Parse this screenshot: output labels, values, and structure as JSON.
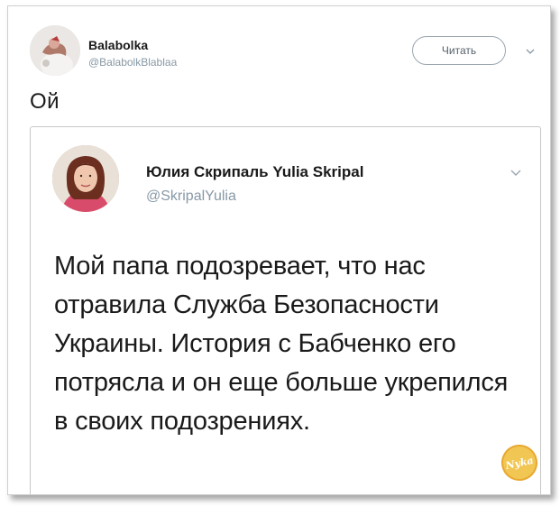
{
  "tweet": {
    "author_name": "Balabolka",
    "author_handle": "@BalabolkBlablaa",
    "follow_label": "Читать",
    "text": "Ой"
  },
  "quoted_tweet": {
    "author_name": "Юлия Скрипаль Yulia Skripal",
    "author_handle": "@SkripalYulia",
    "text": "Мой папа подозревает, что нас отравила Служба Безопасности Украины. История с Бабченко его потрясла и он еще больше укрепился в своих подозрениях."
  },
  "watermark": {
    "text": "Nyka"
  },
  "colors": {
    "text": "#1a1a1a",
    "handle": "#8899a6",
    "border": "#c8c8c8",
    "watermark": "#f1c44a"
  },
  "icons": [
    "avatar",
    "chevron-down-icon",
    "avatar-photo",
    "watermark-logo"
  ]
}
